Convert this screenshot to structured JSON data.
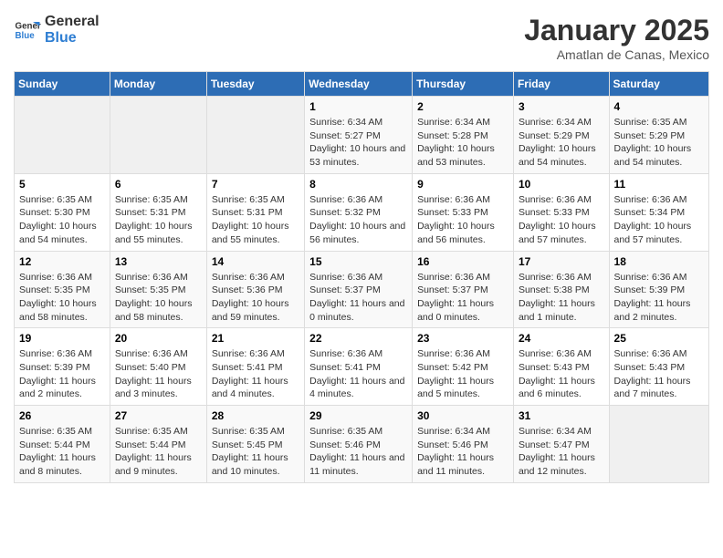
{
  "header": {
    "logo_line1": "General",
    "logo_line2": "Blue",
    "month": "January 2025",
    "location": "Amatlan de Canas, Mexico"
  },
  "weekdays": [
    "Sunday",
    "Monday",
    "Tuesday",
    "Wednesday",
    "Thursday",
    "Friday",
    "Saturday"
  ],
  "weeks": [
    [
      {
        "day": "",
        "empty": true
      },
      {
        "day": "",
        "empty": true
      },
      {
        "day": "",
        "empty": true
      },
      {
        "day": "1",
        "sunrise": "6:34 AM",
        "sunset": "5:27 PM",
        "daylight": "10 hours and 53 minutes."
      },
      {
        "day": "2",
        "sunrise": "6:34 AM",
        "sunset": "5:28 PM",
        "daylight": "10 hours and 53 minutes."
      },
      {
        "day": "3",
        "sunrise": "6:34 AM",
        "sunset": "5:29 PM",
        "daylight": "10 hours and 54 minutes."
      },
      {
        "day": "4",
        "sunrise": "6:35 AM",
        "sunset": "5:29 PM",
        "daylight": "10 hours and 54 minutes."
      }
    ],
    [
      {
        "day": "5",
        "sunrise": "6:35 AM",
        "sunset": "5:30 PM",
        "daylight": "10 hours and 54 minutes."
      },
      {
        "day": "6",
        "sunrise": "6:35 AM",
        "sunset": "5:31 PM",
        "daylight": "10 hours and 55 minutes."
      },
      {
        "day": "7",
        "sunrise": "6:35 AM",
        "sunset": "5:31 PM",
        "daylight": "10 hours and 55 minutes."
      },
      {
        "day": "8",
        "sunrise": "6:36 AM",
        "sunset": "5:32 PM",
        "daylight": "10 hours and 56 minutes."
      },
      {
        "day": "9",
        "sunrise": "6:36 AM",
        "sunset": "5:33 PM",
        "daylight": "10 hours and 56 minutes."
      },
      {
        "day": "10",
        "sunrise": "6:36 AM",
        "sunset": "5:33 PM",
        "daylight": "10 hours and 57 minutes."
      },
      {
        "day": "11",
        "sunrise": "6:36 AM",
        "sunset": "5:34 PM",
        "daylight": "10 hours and 57 minutes."
      }
    ],
    [
      {
        "day": "12",
        "sunrise": "6:36 AM",
        "sunset": "5:35 PM",
        "daylight": "10 hours and 58 minutes."
      },
      {
        "day": "13",
        "sunrise": "6:36 AM",
        "sunset": "5:35 PM",
        "daylight": "10 hours and 58 minutes."
      },
      {
        "day": "14",
        "sunrise": "6:36 AM",
        "sunset": "5:36 PM",
        "daylight": "10 hours and 59 minutes."
      },
      {
        "day": "15",
        "sunrise": "6:36 AM",
        "sunset": "5:37 PM",
        "daylight": "11 hours and 0 minutes."
      },
      {
        "day": "16",
        "sunrise": "6:36 AM",
        "sunset": "5:37 PM",
        "daylight": "11 hours and 0 minutes."
      },
      {
        "day": "17",
        "sunrise": "6:36 AM",
        "sunset": "5:38 PM",
        "daylight": "11 hours and 1 minute."
      },
      {
        "day": "18",
        "sunrise": "6:36 AM",
        "sunset": "5:39 PM",
        "daylight": "11 hours and 2 minutes."
      }
    ],
    [
      {
        "day": "19",
        "sunrise": "6:36 AM",
        "sunset": "5:39 PM",
        "daylight": "11 hours and 2 minutes."
      },
      {
        "day": "20",
        "sunrise": "6:36 AM",
        "sunset": "5:40 PM",
        "daylight": "11 hours and 3 minutes."
      },
      {
        "day": "21",
        "sunrise": "6:36 AM",
        "sunset": "5:41 PM",
        "daylight": "11 hours and 4 minutes."
      },
      {
        "day": "22",
        "sunrise": "6:36 AM",
        "sunset": "5:41 PM",
        "daylight": "11 hours and 4 minutes."
      },
      {
        "day": "23",
        "sunrise": "6:36 AM",
        "sunset": "5:42 PM",
        "daylight": "11 hours and 5 minutes."
      },
      {
        "day": "24",
        "sunrise": "6:36 AM",
        "sunset": "5:43 PM",
        "daylight": "11 hours and 6 minutes."
      },
      {
        "day": "25",
        "sunrise": "6:36 AM",
        "sunset": "5:43 PM",
        "daylight": "11 hours and 7 minutes."
      }
    ],
    [
      {
        "day": "26",
        "sunrise": "6:35 AM",
        "sunset": "5:44 PM",
        "daylight": "11 hours and 8 minutes."
      },
      {
        "day": "27",
        "sunrise": "6:35 AM",
        "sunset": "5:44 PM",
        "daylight": "11 hours and 9 minutes."
      },
      {
        "day": "28",
        "sunrise": "6:35 AM",
        "sunset": "5:45 PM",
        "daylight": "11 hours and 10 minutes."
      },
      {
        "day": "29",
        "sunrise": "6:35 AM",
        "sunset": "5:46 PM",
        "daylight": "11 hours and 11 minutes."
      },
      {
        "day": "30",
        "sunrise": "6:34 AM",
        "sunset": "5:46 PM",
        "daylight": "11 hours and 11 minutes."
      },
      {
        "day": "31",
        "sunrise": "6:34 AM",
        "sunset": "5:47 PM",
        "daylight": "11 hours and 12 minutes."
      },
      {
        "day": "",
        "empty": true
      }
    ]
  ],
  "labels": {
    "sunrise": "Sunrise:",
    "sunset": "Sunset:",
    "daylight": "Daylight:"
  }
}
